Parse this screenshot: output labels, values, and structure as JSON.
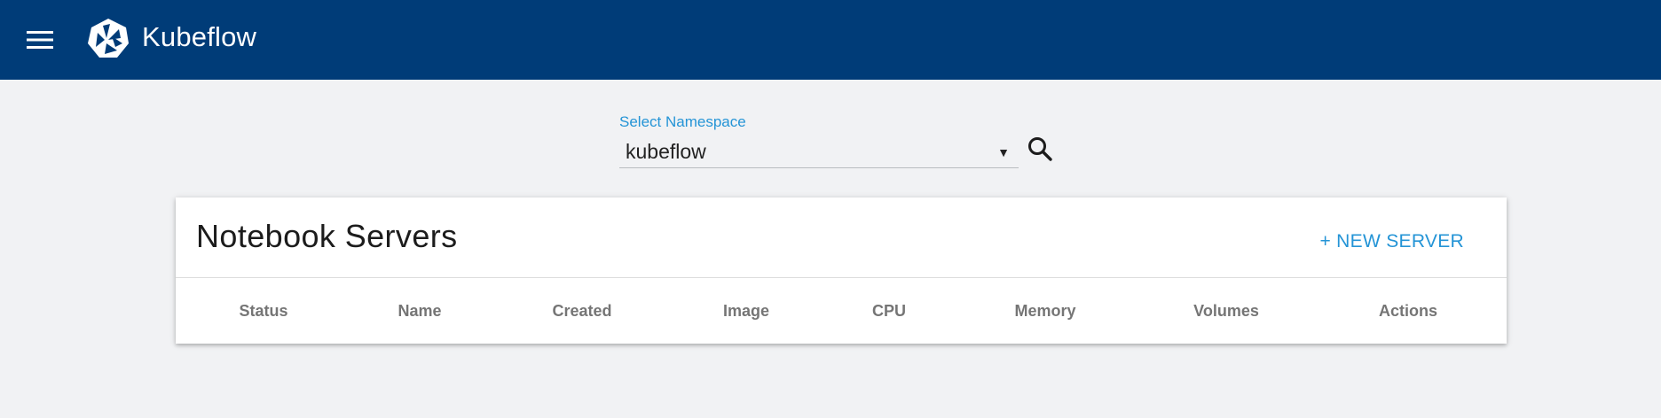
{
  "header": {
    "brand": "Kubeflow",
    "menu_icon": "hamburger-menu-icon",
    "logo_icon": "kubeflow-logo-icon",
    "background_color": "#003c78"
  },
  "namespace": {
    "label": "Select Namespace",
    "value": "kubeflow",
    "label_color": "#2494d6"
  },
  "search": {
    "icon": "search-icon"
  },
  "notebooks": {
    "title": "Notebook Servers",
    "new_server_label": "+ NEW SERVER",
    "columns": [
      "Status",
      "Name",
      "Created",
      "Image",
      "CPU",
      "Memory",
      "Volumes",
      "Actions"
    ],
    "rows": []
  }
}
